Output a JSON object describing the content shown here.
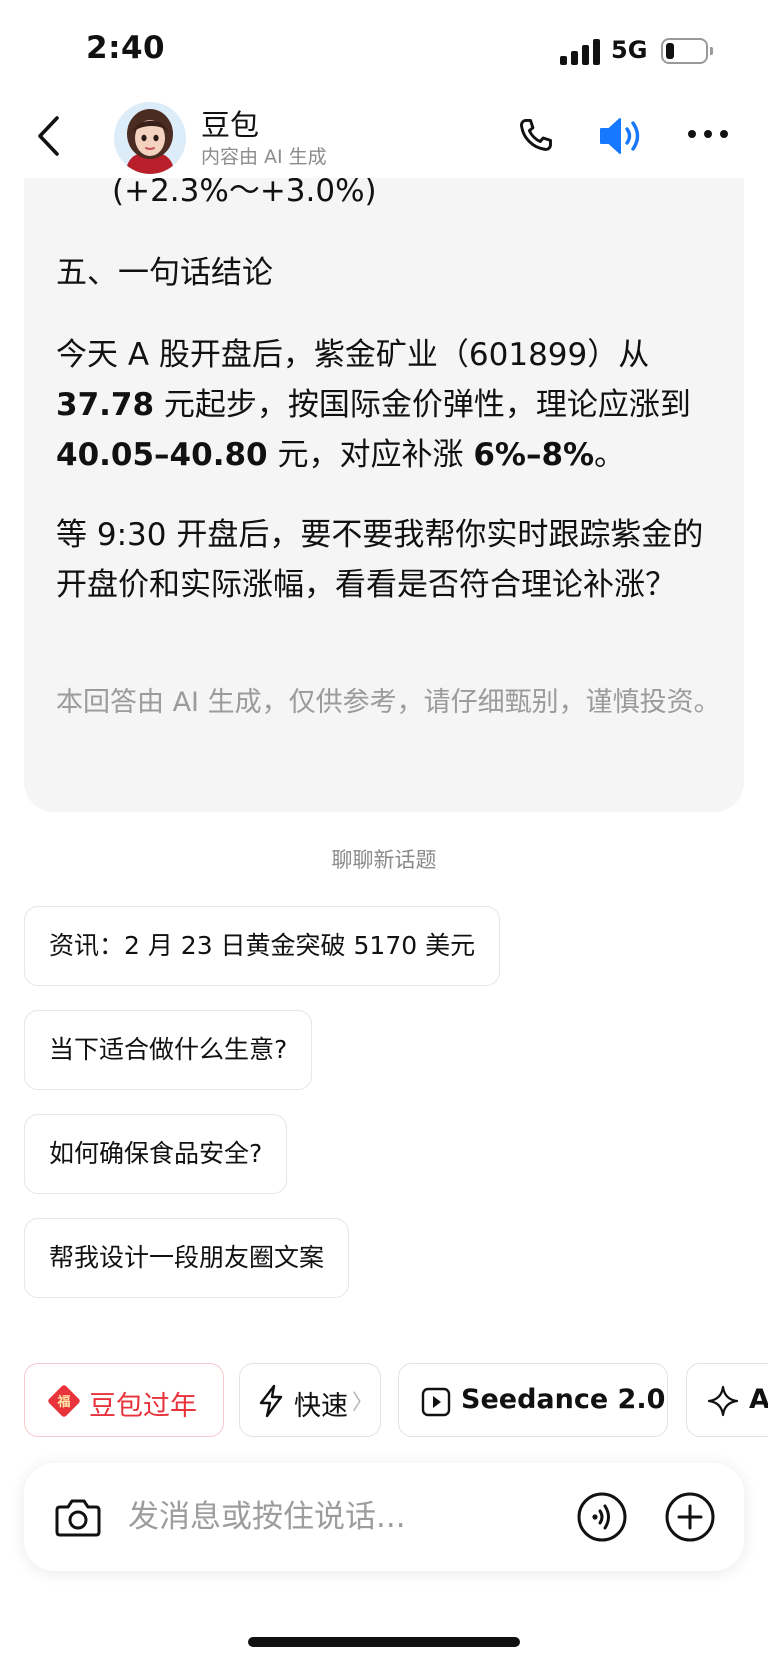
{
  "status_bar": {
    "time": "2:40",
    "network": "5G"
  },
  "header": {
    "title": "豆包",
    "subtitle": "内容由 AI 生成",
    "accent_color": "#1677ff"
  },
  "message": {
    "previous_line": "(+2.3%～+3.0%)",
    "section_title": "五、一句话结论",
    "para1": {
      "t1": "今天 A 股开盘后，紫金矿业（601899）从 ",
      "b1": "37.78",
      "t2": " 元起步，按国际金价弹性，理论应涨到 ",
      "b2": "40.05–40.80",
      "t3": " 元，对应补涨 ",
      "b3": "6%–8%",
      "t4": "。"
    },
    "para2": "等 9:30 开盘后，要不要我帮你实时跟踪紫金的开盘价和实际涨幅，看看是否符合理论补涨？",
    "disclaimer": "本回答由 AI 生成，仅供参考，请仔细甄别，谨慎投资。"
  },
  "new_topic_label": "聊聊新话题",
  "suggestions": [
    "资讯：2 月 23 日黄金突破 5170 美元",
    "当下适合做什么生意?",
    "如何确保食品安全?",
    "帮我设计一段朋友圈文案"
  ],
  "chips": {
    "new_year": {
      "label": "豆包过年",
      "badge": "福",
      "color": "#e8323c"
    },
    "fast": {
      "label": "快速",
      "arrow": "〉"
    },
    "seedance": {
      "label": "Seedance 2.0"
    },
    "partial": {
      "label": "A"
    }
  },
  "input": {
    "placeholder": "发消息或按住说话..."
  }
}
